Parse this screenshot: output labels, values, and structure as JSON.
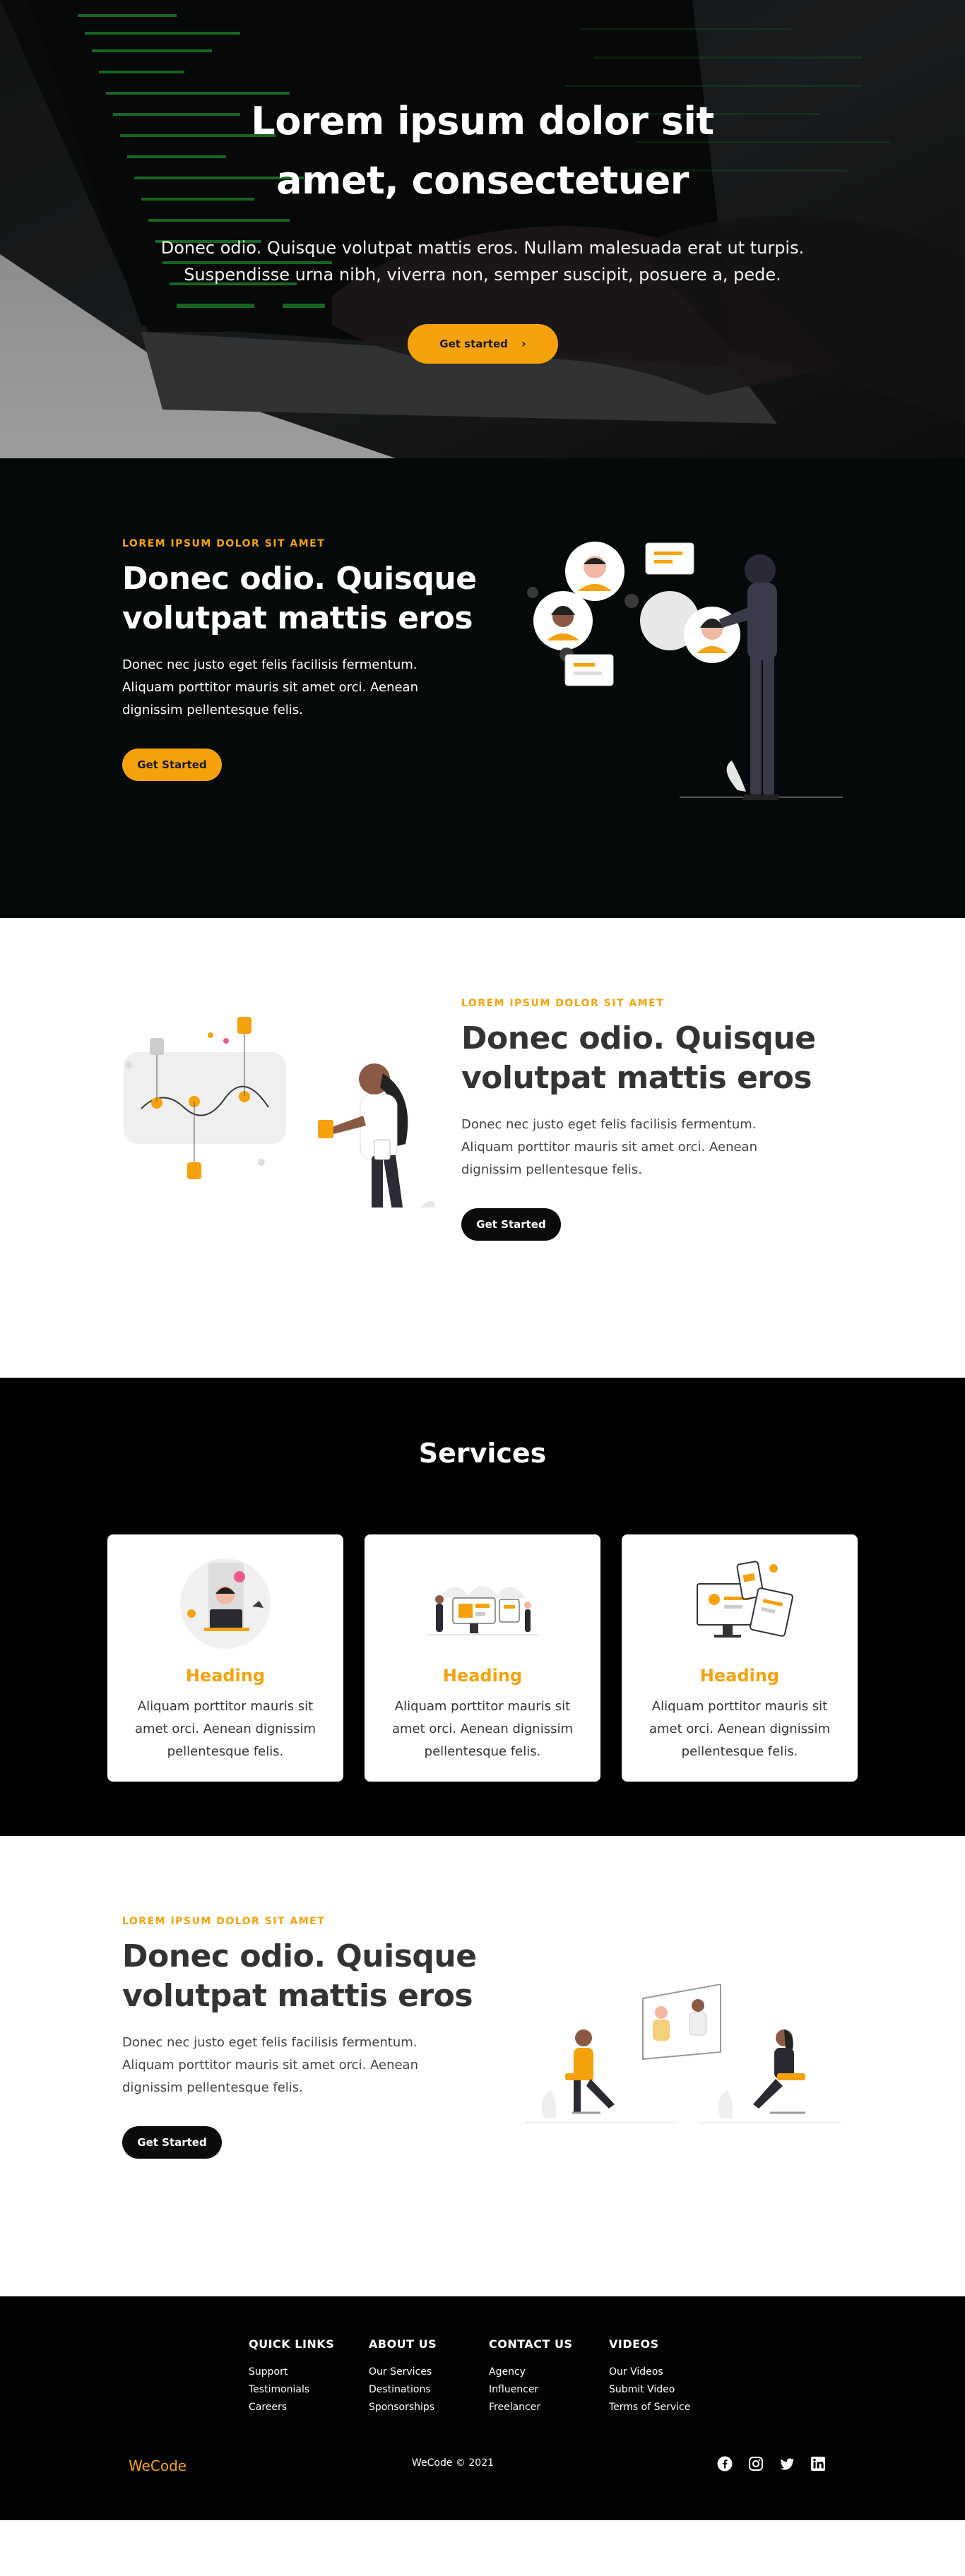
{
  "hero": {
    "title": "Lorem ipsum dolor sit amet, consectetuer",
    "subtitle": "Donec odio. Quisque volutpat mattis eros. Nullam malesuada erat ut turpis. Suspendisse urna nibh, viverra non, semper suscipit, posuere a, pede.",
    "cta_label": "Get started",
    "cta_icon": "chevron-right-icon"
  },
  "feature1": {
    "eyebrow": "LOREM IPSUM DOLOR SIT AMET",
    "heading": "Donec odio. Quisque volutpat mattis eros",
    "body": "Donec nec justo eget felis facilisis fermentum. Aliquam porttitor mauris sit amet orci. Aenean dignissim pellentesque felis.",
    "cta_label": "Get Started"
  },
  "feature2": {
    "eyebrow": "LOREM IPSUM DOLOR SIT AMET",
    "heading": "Donec odio. Quisque volutpat mattis eros",
    "body": "Donec nec justo eget felis facilisis fermentum. Aliquam porttitor mauris sit amet orci. Aenean dignissim pellentesque felis.",
    "cta_label": "Get Started"
  },
  "services": {
    "title": "Services",
    "cards": [
      {
        "heading": "Heading",
        "text": "Aliquam porttitor mauris sit amet orci. Aenean dignissim pellentesque felis."
      },
      {
        "heading": "Heading",
        "text": "Aliquam porttitor mauris sit amet orci. Aenean dignissim pellentesque felis."
      },
      {
        "heading": "Heading",
        "text": "Aliquam porttitor mauris sit amet orci. Aenean dignissim pellentesque felis."
      }
    ]
  },
  "feature3": {
    "eyebrow": "LOREM IPSUM DOLOR SIT AMET",
    "heading": "Donec odio. Quisque volutpat mattis eros",
    "body": "Donec nec justo eget felis facilisis fermentum. Aliquam porttitor mauris sit amet orci. Aenean dignissim pellentesque felis.",
    "cta_label": "Get Started"
  },
  "footer": {
    "columns": [
      {
        "title": "QUICK LINKS",
        "links": [
          "Support",
          "Testimonials",
          "Careers"
        ]
      },
      {
        "title": "ABOUT US",
        "links": [
          "Our Services",
          "Destinations",
          "Sponsorships"
        ]
      },
      {
        "title": "CONTACT US",
        "links": [
          "Agency",
          "Influencer",
          "Freelancer"
        ]
      },
      {
        "title": "VIDEOS",
        "links": [
          "Our Videos",
          "Submit Video",
          "Terms of Service"
        ]
      }
    ],
    "brand": "WeCode",
    "copyright": "WeCode © 2021",
    "social_icons": [
      "facebook-icon",
      "instagram-icon",
      "twitter-icon",
      "linkedin-icon"
    ]
  },
  "colors": {
    "accent": "#f5a20c",
    "dark": "#060909",
    "black": "#000000"
  }
}
